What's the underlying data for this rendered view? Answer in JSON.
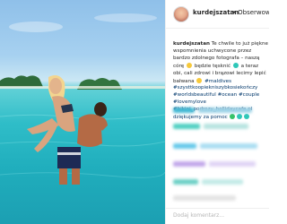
{
  "post": {
    "username": "kurdejszatan",
    "follow_separator": "•",
    "follow_label": "Obserwowanie",
    "caption_user": "kurdejszatan",
    "caption_text": "Te chwile to już piękne wspomnienia uchwycone przez bardzo zdolnego fotografa – naszą córę",
    "caption_text_2": "będzie tęsknić",
    "caption_text_3": "a teraz obi, cali zdrowi i brązowi lecimy lepić bałwana",
    "caption_hashtags": "#maldives #szysttkoopiekniszybkosiekończy #worldsbeautiful #ocean #couple #lovemylove #bikini_podrozy_hollidaycafe.pl dziękujemy za pomoc"
  },
  "comment_input": {
    "placeholder": "Dodaj komentarz..."
  },
  "colors": {
    "accent": "#3897f0",
    "hashtag": "#00376b",
    "text": "#262626",
    "muted": "#b5b5b5"
  }
}
